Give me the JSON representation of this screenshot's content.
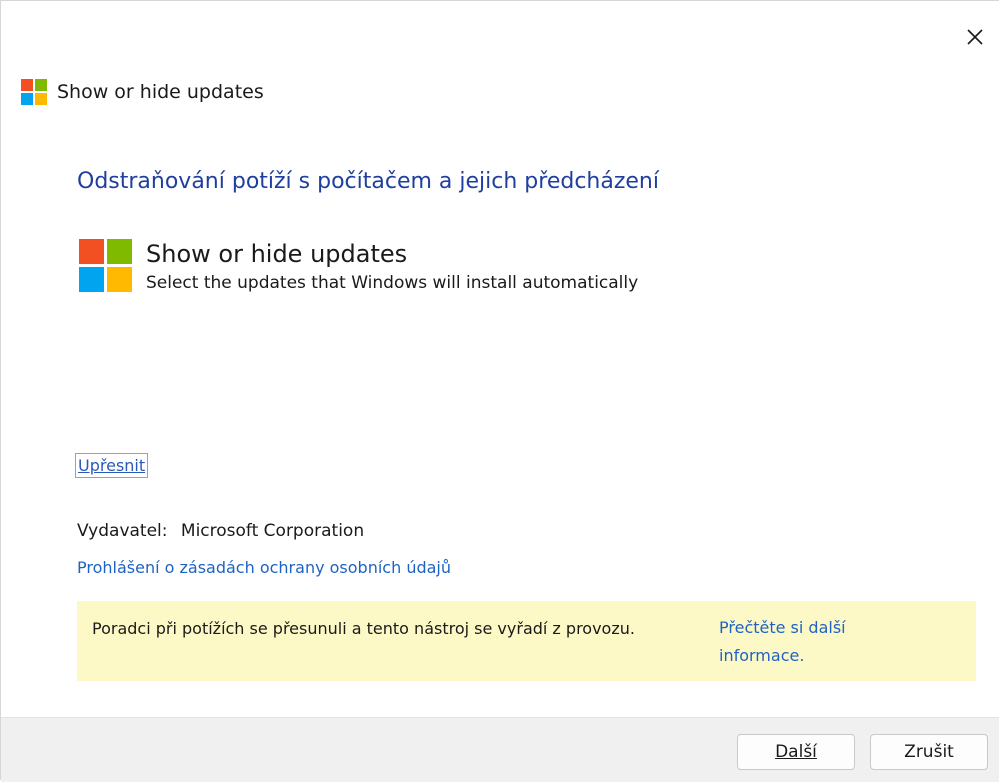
{
  "window": {
    "title": "Show or hide updates",
    "close_icon": "close-icon"
  },
  "main": {
    "heading": "Odstraňování potíží s počítačem a jejich předcházení",
    "tool_name": "Show or hide updates",
    "tool_description": "Select the updates that Windows will install automatically",
    "advanced_link": "Upřesnit",
    "publisher_label": "Vydavatel:",
    "publisher_value": "Microsoft Corporation",
    "privacy_link": "Prohlášení o zásadách ochrany osobních údajů"
  },
  "notice": {
    "message": "Poradci při potížích se přesunuli a tento nástroj se vyřadí z provozu.",
    "more_info_link": "Přečtěte si další informace."
  },
  "footer": {
    "next_label": "Další",
    "cancel_label": "Zrušit"
  },
  "colors": {
    "heading": "#1f3f9e",
    "link": "#1e63c4",
    "notice_bg": "#fdf9c6",
    "logo_red": "#f25022",
    "logo_green": "#7fba00",
    "logo_blue": "#00a4ef",
    "logo_yellow": "#ffb900"
  }
}
